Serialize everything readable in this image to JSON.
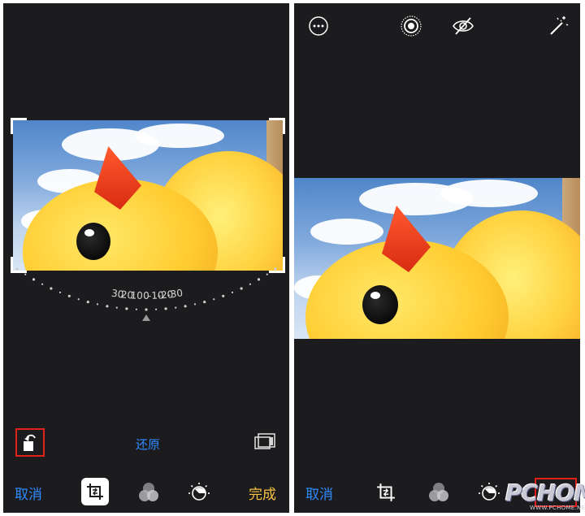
{
  "left_screen": {
    "dial": {
      "labels": [
        "-30",
        "-20",
        "-10",
        "0",
        "10",
        "20",
        "30"
      ]
    },
    "reset_label": "还原",
    "cancel_label": "取消",
    "done_label": "完成",
    "icons": {
      "rotate": "rotate-icon",
      "aspect": "aspect-ratio-icon",
      "crop": "crop-icon",
      "filters": "filters-icon",
      "adjust": "adjust-icon"
    }
  },
  "right_screen": {
    "cancel_label": "取消",
    "icons": {
      "more": "more-icon",
      "live": "live-photo-icon",
      "hide": "eye-slash-icon",
      "auto_enhance": "magic-wand-icon",
      "crop": "crop-icon",
      "filters": "filters-icon",
      "adjust": "adjust-icon"
    }
  },
  "watermark": {
    "main": "PCHOME",
    "sub": "WWW.PCHOME.NET"
  },
  "colors": {
    "background": "#1c1c1e",
    "accent_blue": "#2e8bff",
    "done_gold": "#f6c043",
    "highlight_red": "#e1221c"
  }
}
